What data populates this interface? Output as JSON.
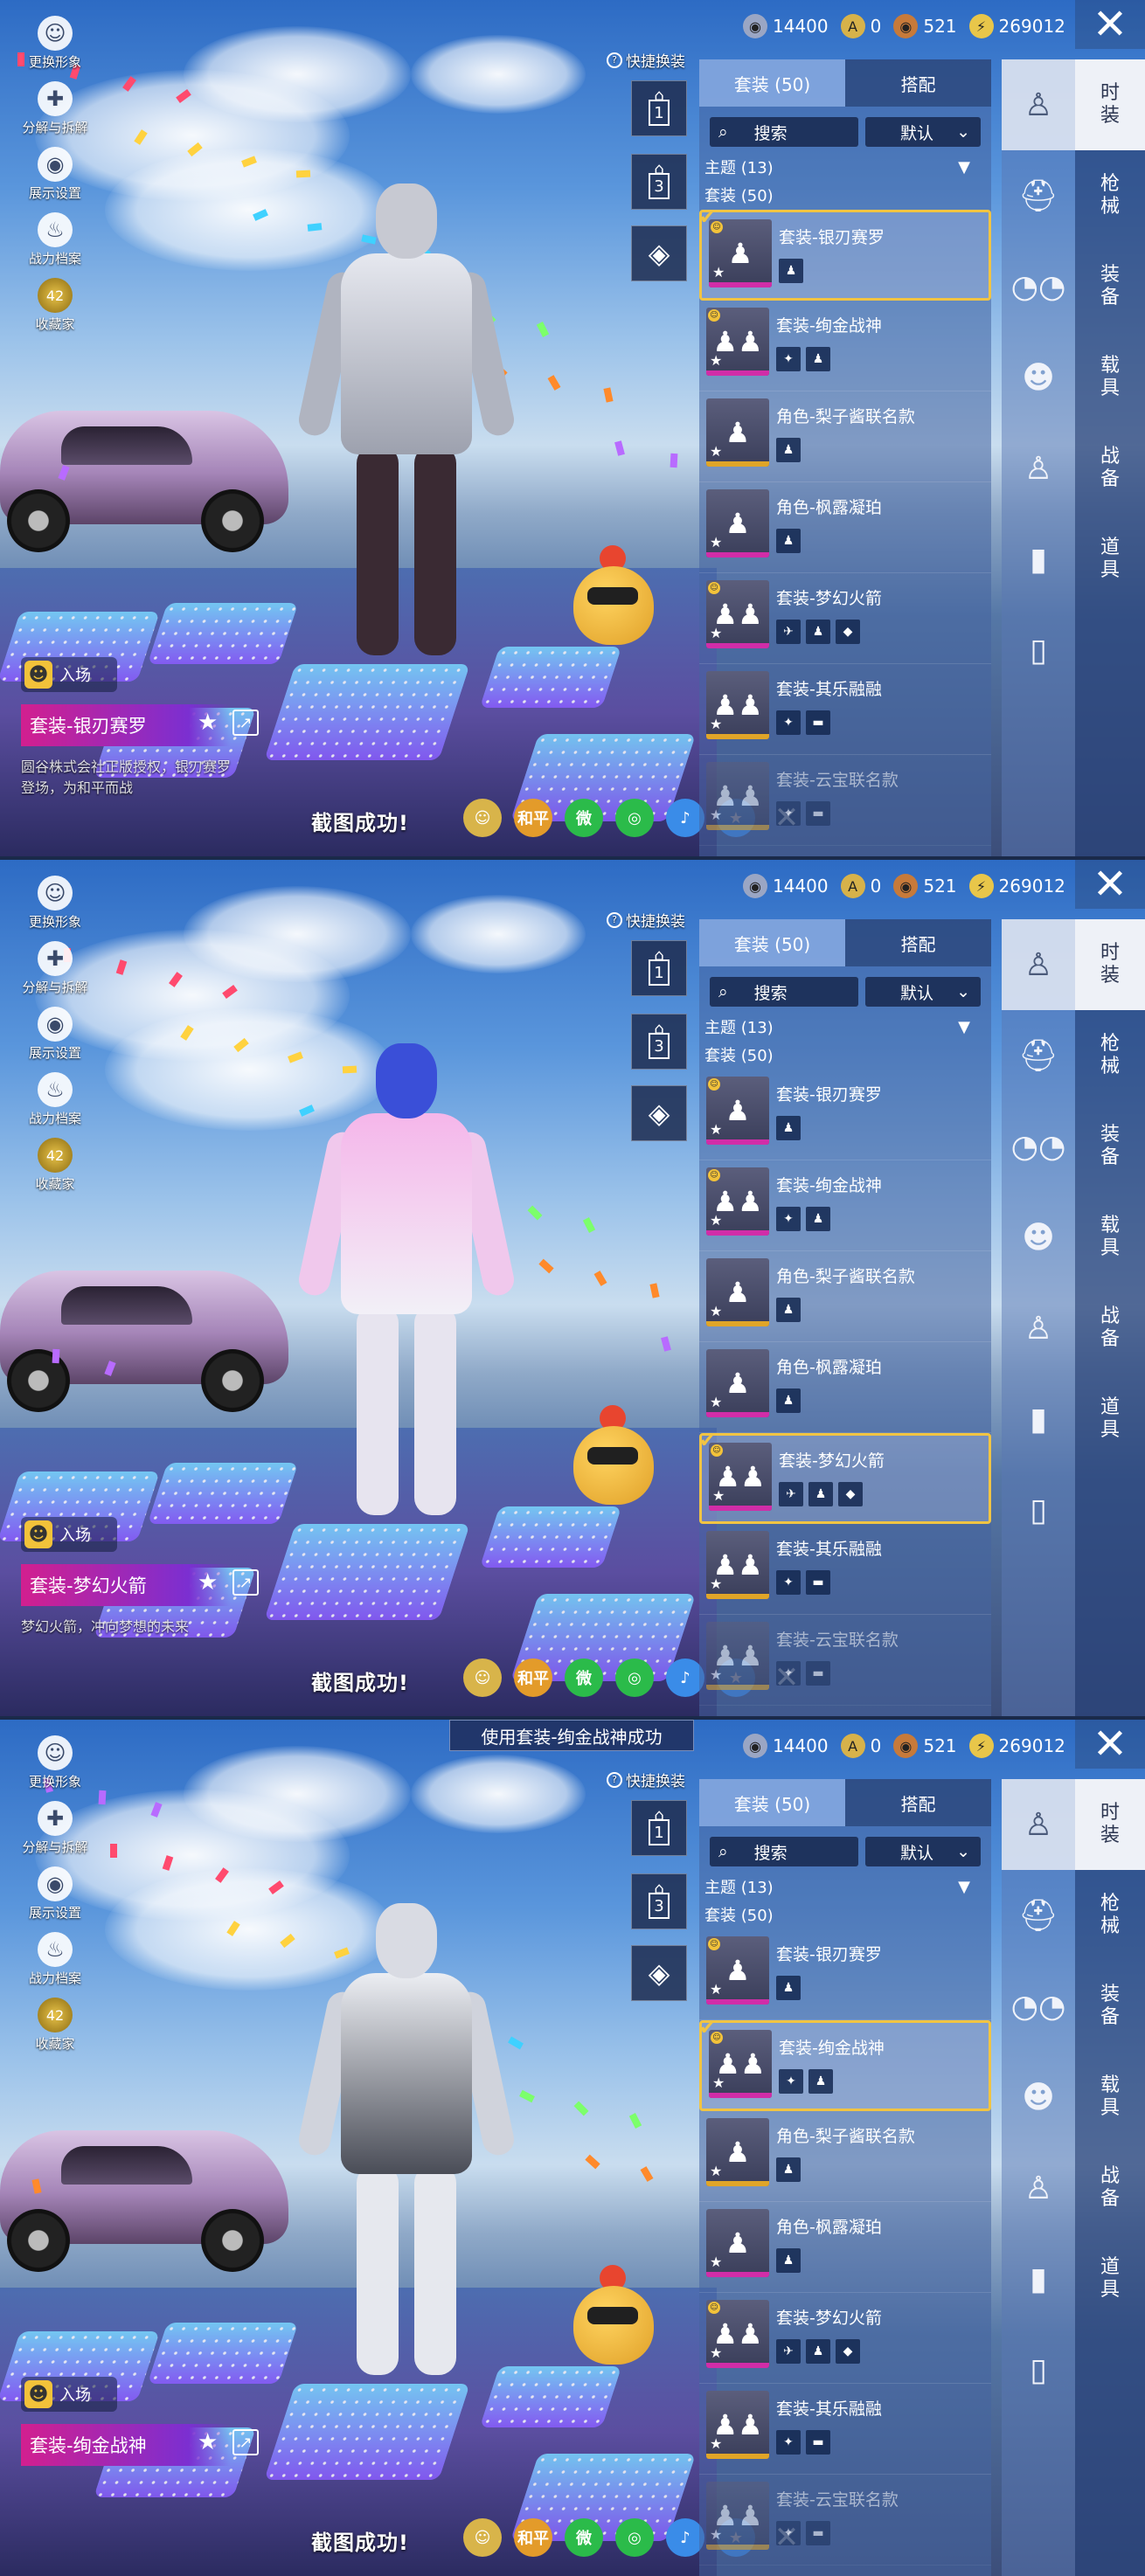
{
  "currency": {
    "silver": "14400",
    "pass": "0",
    "bronze": "521",
    "uc": "269012"
  },
  "left_menu": [
    {
      "label": "更换形象",
      "icon": "avatar-icon"
    },
    {
      "label": "分解与拆解",
      "icon": "puzzle-icon"
    },
    {
      "label": "展示设置",
      "icon": "eye-icon"
    },
    {
      "label": "战力档案",
      "icon": "flame-icon"
    },
    {
      "label": "收藏家",
      "icon": "collector-badge-icon",
      "badge": "42"
    }
  ],
  "quick_swap": "快捷换装",
  "presets": [
    "1",
    "3"
  ],
  "entry_label": "入场",
  "tabs": {
    "outfits": "套装 (50)",
    "match": "搭配"
  },
  "search": {
    "label": "搜索",
    "sort": "默认"
  },
  "theme_label": "主题 (13)",
  "group_label": "套装 (50)",
  "items": [
    {
      "name": "套装-银刃赛罗",
      "subs": [
        "♟"
      ]
    },
    {
      "name": "套装-绚金战神",
      "subs": [
        "✦",
        "♟"
      ]
    },
    {
      "name": "角色-梨子酱联名款",
      "subs": [
        "♟"
      ]
    },
    {
      "name": "角色-枫露凝珀",
      "subs": [
        "♟"
      ]
    },
    {
      "name": "套装-梦幻火箭",
      "subs": [
        "✈",
        "♟",
        "◆"
      ]
    },
    {
      "name": "套装-其乐融融",
      "subs": [
        "✦",
        "▬"
      ]
    },
    {
      "name": "套装-云宝联名款",
      "subs": [
        "✦",
        "▬"
      ]
    }
  ],
  "categories": [
    "时\n装",
    "枪\n械",
    "装\n备",
    "载\n具",
    "战\n备",
    "道\n具"
  ],
  "strip_icons": [
    "outfit-icon",
    "helmet-icon",
    "glasses-icon",
    "mask-icon",
    "figure-icon",
    "pants-icon",
    "shoes-icon"
  ],
  "screenshot_success": "截图成功!",
  "share_targets": [
    "☺",
    "和平",
    "微",
    "◎",
    "♪",
    "★"
  ],
  "panels": [
    {
      "suit_name": "套装-银刃赛罗",
      "selected": 0,
      "desc": "圆谷株式会社正版授权，银刃赛罗登场，为和平而战",
      "toast": ""
    },
    {
      "suit_name": "套装-梦幻火箭",
      "selected": 4,
      "desc": "梦幻火箭，冲向梦想的未来",
      "toast": ""
    },
    {
      "suit_name": "套装-绚金战神",
      "selected": 1,
      "desc": "",
      "toast": "使用套装-绚金战神成功"
    }
  ],
  "colors": {
    "gold": "#f1c443",
    "accent_pink": "#d21f8f",
    "panel": "#46649f"
  }
}
